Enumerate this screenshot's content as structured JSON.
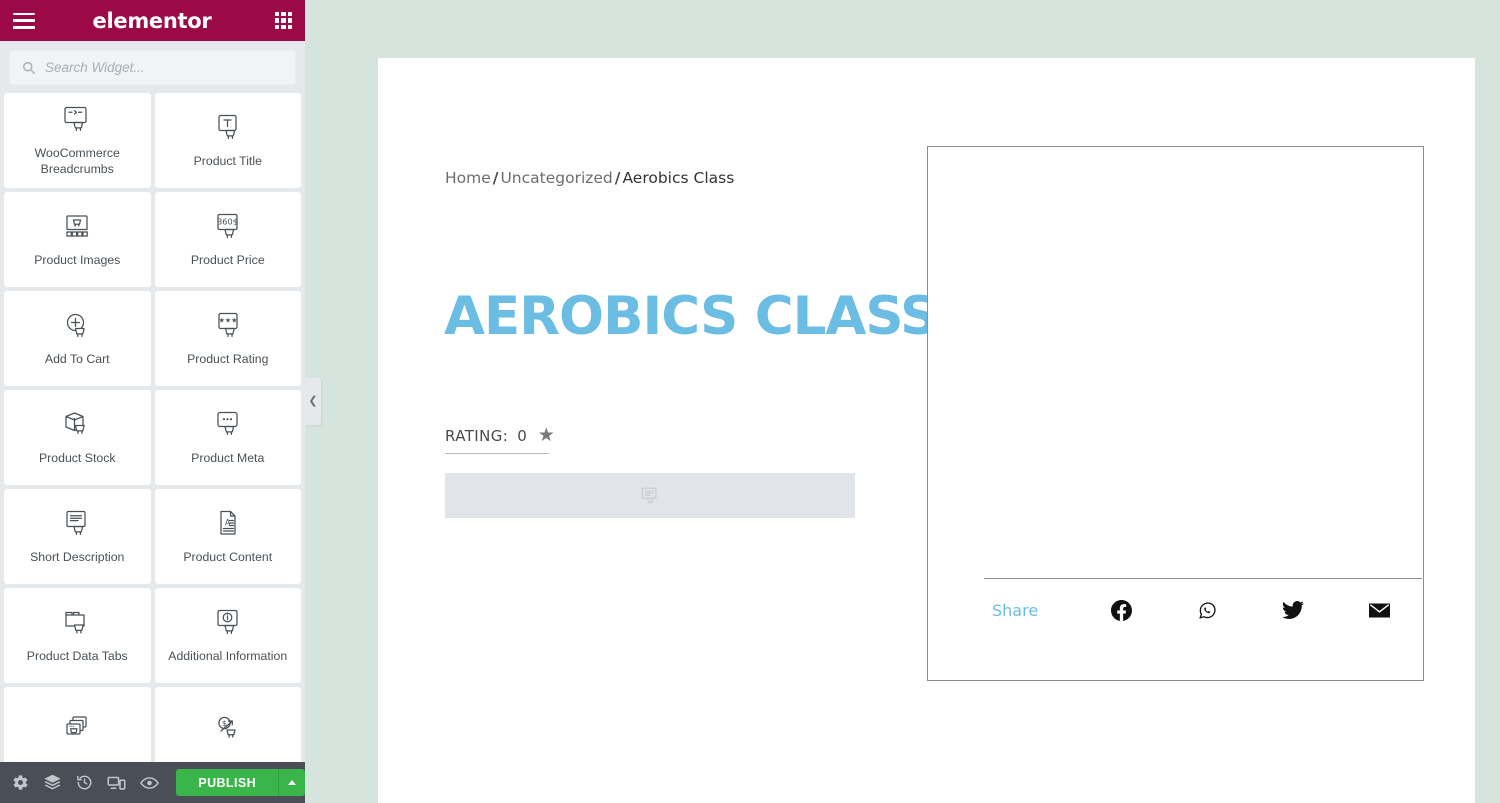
{
  "app": {
    "brand": "elementor",
    "menu_icon": "hamburger-icon",
    "apps_icon": "apps-grid-icon"
  },
  "search": {
    "placeholder": "Search Widget...",
    "value": "",
    "icon": "search-icon"
  },
  "widgets": [
    {
      "label": "WooCommerce Breadcrumbs",
      "icon": "breadcrumbs-cart-icon"
    },
    {
      "label": "Product Title",
      "icon": "text-cart-icon"
    },
    {
      "label": "Product Images",
      "icon": "product-images-icon"
    },
    {
      "label": "Product Price",
      "icon": "price-360-cart-icon"
    },
    {
      "label": "Add To Cart",
      "icon": "add-to-cart-icon"
    },
    {
      "label": "Product Rating",
      "icon": "stars-cart-icon"
    },
    {
      "label": "Product Stock",
      "icon": "box-cart-icon"
    },
    {
      "label": "Product Meta",
      "icon": "dots-cart-icon"
    },
    {
      "label": "Short Description",
      "icon": "lines-cart-icon"
    },
    {
      "label": "Product Content",
      "icon": "document-a-icon"
    },
    {
      "label": "Product Data Tabs",
      "icon": "folder-cart-icon"
    },
    {
      "label": "Additional Information",
      "icon": "info-cart-icon"
    },
    {
      "label": "",
      "icon": "stacked-windows-cart-icon"
    },
    {
      "label": "",
      "icon": "upsell-dollar-cart-icon"
    }
  ],
  "toolbar": {
    "items": [
      {
        "name": "settings",
        "icon": "gear-icon"
      },
      {
        "name": "navigator",
        "icon": "layers-icon"
      },
      {
        "name": "history",
        "icon": "history-icon"
      },
      {
        "name": "responsive-mode",
        "icon": "responsive-icon"
      },
      {
        "name": "preview",
        "icon": "eye-icon"
      }
    ],
    "publish_label": "PUBLISH",
    "publish_arrow_icon": "chevron-up-icon",
    "publish_color": "#39b54a"
  },
  "collapse": {
    "icon": "chevron-left-icon"
  },
  "canvas": {
    "breadcrumb": {
      "items": [
        "Home",
        "Uncategorized",
        "Aerobics Class"
      ],
      "separator": "/"
    },
    "title": "AEROBICS CLASS",
    "title_color": "#6cbde3",
    "rating": {
      "label": "RATING:",
      "value": "0",
      "star_icon": "star-icon"
    },
    "short_description_placeholder_icon": "lines-cart-icon",
    "share": {
      "label": "Share",
      "label_color": "#6cbde3",
      "networks": [
        {
          "name": "facebook",
          "icon": "facebook-icon"
        },
        {
          "name": "whatsapp",
          "icon": "whatsapp-icon"
        },
        {
          "name": "twitter",
          "icon": "twitter-icon"
        },
        {
          "name": "email",
          "icon": "envelope-icon"
        }
      ]
    }
  },
  "colors": {
    "header": "#9b0a46",
    "panel_bg": "#e6e9ec",
    "toolbar_bg": "#4a4f57",
    "canvas_bg": "#d6e4de"
  }
}
